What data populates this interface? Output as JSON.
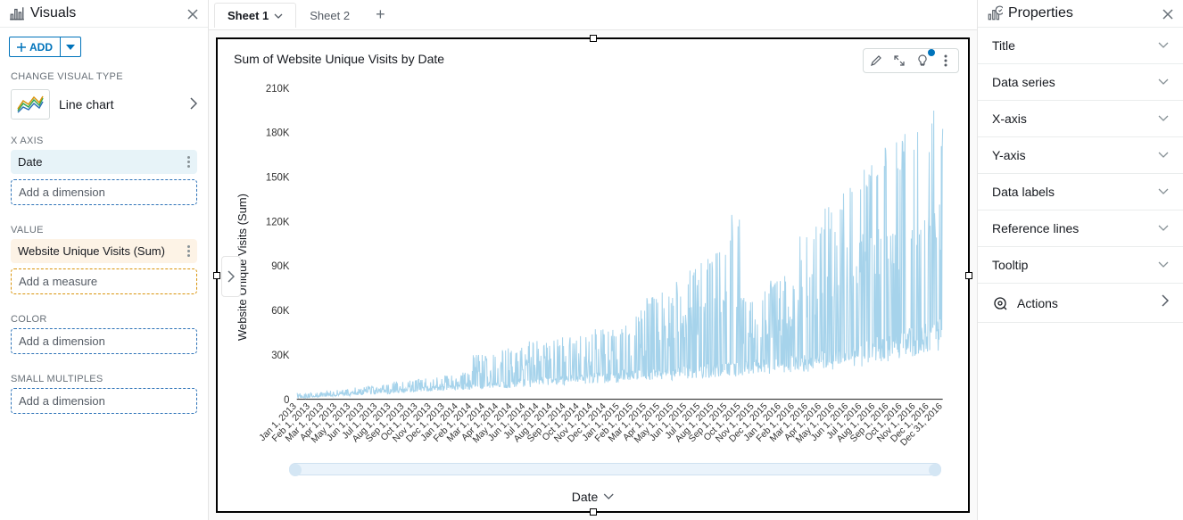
{
  "visuals_panel": {
    "title": "Visuals",
    "add_button": "ADD",
    "change_type_label": "CHANGE VISUAL TYPE",
    "chart_type": "Line chart",
    "sections": {
      "xaxis": {
        "label": "X AXIS",
        "field": "Date",
        "placeholder": "Add a dimension"
      },
      "value": {
        "label": "VALUE",
        "field": "Website Unique Visits (Sum)",
        "placeholder": "Add a measure"
      },
      "color": {
        "label": "COLOR",
        "placeholder": "Add a dimension"
      },
      "small_multiples": {
        "label": "SMALL MULTIPLES",
        "placeholder": "Add a dimension"
      }
    }
  },
  "tabs": {
    "active": "Sheet 1",
    "inactive": "Sheet 2"
  },
  "card": {
    "title": "Sum of Website Unique Visits by Date",
    "ylabel": "Website Unique Visits (Sum)",
    "xlabel": "Date"
  },
  "properties_panel": {
    "title": "Properties",
    "rows": [
      "Title",
      "Data series",
      "X-axis",
      "Y-axis",
      "Data labels",
      "Reference lines",
      "Tooltip"
    ],
    "actions": "Actions"
  },
  "chart_data": {
    "type": "line",
    "title": "Sum of Website Unique Visits by Date",
    "xlabel": "Date",
    "ylabel": "Website Unique Visits (Sum)",
    "ylim": [
      0,
      210000
    ],
    "yticks": [
      0,
      30000,
      60000,
      90000,
      120000,
      150000,
      180000,
      210000
    ],
    "ytick_labels": [
      "0",
      "30K",
      "60K",
      "90K",
      "120K",
      "150K",
      "180K",
      "210K"
    ],
    "xticks": [
      "Jan 1, 2013",
      "Feb 1, 2013",
      "Mar 1, 2013",
      "Apr 1, 2013",
      "May 1, 2013",
      "Jun 1, 2013",
      "Jul 1, 2013",
      "Aug 1, 2013",
      "Sep 1, 2013",
      "Oct 1, 2013",
      "Nov 1, 2013",
      "Dec 1, 2013",
      "Jan 1, 2014",
      "Feb 1, 2014",
      "Mar 1, 2014",
      "Apr 1, 2014",
      "May 1, 2014",
      "Jun 1, 2014",
      "Jul 1, 2014",
      "Aug 1, 2014",
      "Sep 1, 2014",
      "Oct 1, 2014",
      "Nov 1, 2014",
      "Dec 1, 2014",
      "Jan 1, 2015",
      "Feb 1, 2015",
      "Mar 1, 2015",
      "Apr 1, 2015",
      "May 1, 2015",
      "Jun 1, 2015",
      "Jul 1, 2015",
      "Aug 1, 2015",
      "Sep 1, 2015",
      "Oct 1, 2015",
      "Nov 1, 2015",
      "Dec 1, 2015",
      "Jan 1, 2016",
      "Feb 1, 2016",
      "Mar 1, 2016",
      "Apr 1, 2016",
      "May 1, 2016",
      "Jun 1, 2016",
      "Jul 1, 2016",
      "Aug 1, 2016",
      "Sep 1, 2016",
      "Oct 1, 2016",
      "Nov 1, 2016",
      "Dec 1, 2016",
      "Dec 31, 2016"
    ],
    "series": [
      {
        "name": "Website Unique Visits (Sum)",
        "color": "#a6d3eb",
        "approx_monthly_trend": [
          {
            "x": "Jan 2013",
            "low": 1000,
            "high": 4000
          },
          {
            "x": "Feb 2013",
            "low": 1500,
            "high": 5000
          },
          {
            "x": "Mar 2013",
            "low": 2000,
            "high": 6000
          },
          {
            "x": "Apr 2013",
            "low": 2500,
            "high": 7000
          },
          {
            "x": "May 2013",
            "low": 3000,
            "high": 8000
          },
          {
            "x": "Jun 2013",
            "low": 3500,
            "high": 9000
          },
          {
            "x": "Jul 2013",
            "low": 4000,
            "high": 10000
          },
          {
            "x": "Aug 2013",
            "low": 4500,
            "high": 12000
          },
          {
            "x": "Sep 2013",
            "low": 5000,
            "high": 13000
          },
          {
            "x": "Oct 2013",
            "low": 5500,
            "high": 14000
          },
          {
            "x": "Nov 2013",
            "low": 6000,
            "high": 15000
          },
          {
            "x": "Dec 2013",
            "low": 6500,
            "high": 16000
          },
          {
            "x": "Jan 2014",
            "low": 7000,
            "high": 18000
          },
          {
            "x": "Feb 2014",
            "low": 7000,
            "high": 30000
          },
          {
            "x": "Mar 2014",
            "low": 8000,
            "high": 30000
          },
          {
            "x": "Apr 2014",
            "low": 8000,
            "high": 35000
          },
          {
            "x": "May 2014",
            "low": 9000,
            "high": 35000
          },
          {
            "x": "Jun 2014",
            "low": 9000,
            "high": 40000
          },
          {
            "x": "Jul 2014",
            "low": 10000,
            "high": 40000
          },
          {
            "x": "Aug 2014",
            "low": 10000,
            "high": 42000
          },
          {
            "x": "Sep 2014",
            "low": 11000,
            "high": 42000
          },
          {
            "x": "Oct 2014",
            "low": 11000,
            "high": 45000
          },
          {
            "x": "Nov 2014",
            "low": 12000,
            "high": 48000
          },
          {
            "x": "Dec 2014",
            "low": 12000,
            "high": 48000
          },
          {
            "x": "Jan 2015",
            "low": 13000,
            "high": 50000
          },
          {
            "x": "Feb 2015",
            "low": 13000,
            "high": 60000
          },
          {
            "x": "Mar 2015",
            "low": 14000,
            "high": 70000
          },
          {
            "x": "Apr 2015",
            "low": 14000,
            "high": 72000
          },
          {
            "x": "May 2015",
            "low": 15000,
            "high": 80000
          },
          {
            "x": "Jun 2015",
            "low": 15000,
            "high": 90000
          },
          {
            "x": "Jul 2015",
            "low": 16000,
            "high": 100000
          },
          {
            "x": "Aug 2015",
            "low": 16000,
            "high": 110000
          },
          {
            "x": "Sep 2015",
            "low": 17000,
            "high": 125000
          },
          {
            "x": "Oct 2015",
            "low": 18000,
            "high": 70000
          },
          {
            "x": "Nov 2015",
            "low": 18000,
            "high": 75000
          },
          {
            "x": "Dec 2015",
            "low": 19000,
            "high": 80000
          },
          {
            "x": "Jan 2016",
            "low": 20000,
            "high": 85000
          },
          {
            "x": "Feb 2016",
            "low": 20000,
            "high": 110000
          },
          {
            "x": "Mar 2016",
            "low": 22000,
            "high": 120000
          },
          {
            "x": "Apr 2016",
            "low": 22000,
            "high": 130000
          },
          {
            "x": "May 2016",
            "low": 24000,
            "high": 150000
          },
          {
            "x": "Jun 2016",
            "low": 24000,
            "high": 155000
          },
          {
            "x": "Jul 2016",
            "low": 26000,
            "high": 160000
          },
          {
            "x": "Aug 2016",
            "low": 28000,
            "high": 170000
          },
          {
            "x": "Sep 2016",
            "low": 30000,
            "high": 175000
          },
          {
            "x": "Oct 2016",
            "low": 32000,
            "high": 180000
          },
          {
            "x": "Nov 2016",
            "low": 34000,
            "high": 190000
          },
          {
            "x": "Dec 2016",
            "low": 36000,
            "high": 195000
          }
        ]
      }
    ]
  }
}
